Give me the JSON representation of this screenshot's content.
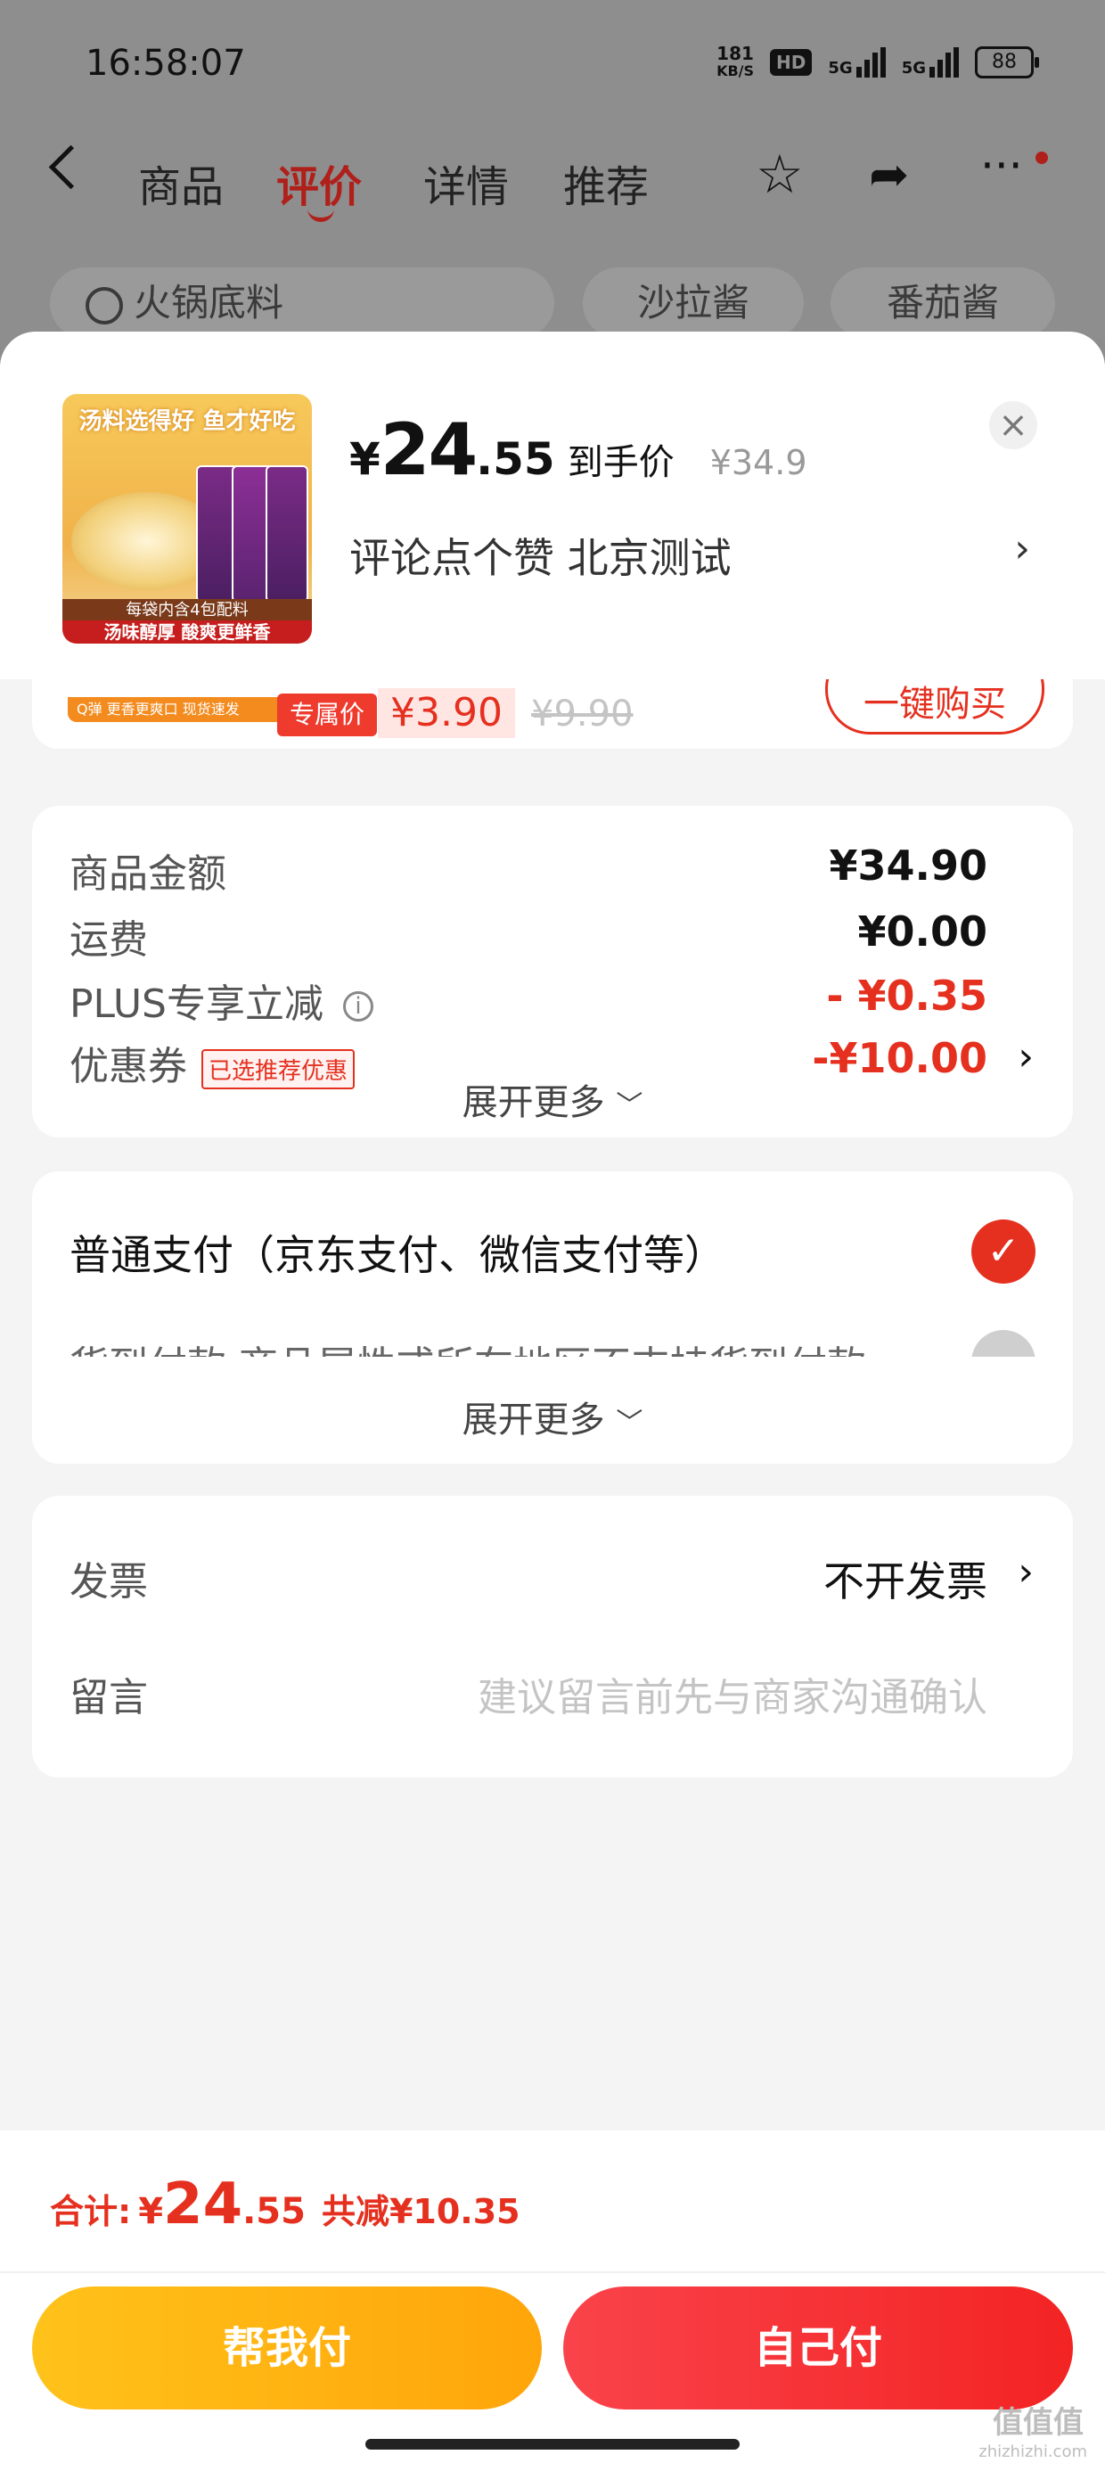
{
  "status_bar": {
    "time": "16:58:07",
    "net_speed_value": "181",
    "net_speed_unit": "KB/S",
    "hd_label": "HD",
    "signal1_label": "5G",
    "signal2_label": "5G",
    "battery": "88"
  },
  "nav": {
    "tabs": [
      {
        "label": "商品"
      },
      {
        "label": "评价"
      },
      {
        "label": "详情"
      },
      {
        "label": "推荐"
      }
    ],
    "active_tab": "评价",
    "icons": [
      "back-icon",
      "star-icon",
      "share-icon",
      "more-icon"
    ]
  },
  "search_row": {
    "search_text": "火锅底料",
    "chips": [
      "沙拉酱",
      "番茄酱"
    ]
  },
  "product": {
    "image_top_text": "汤料选得好 鱼才好吃",
    "image_band1": "每袋内含4包配料",
    "image_band2": "汤味醇厚 酸爽更鲜香",
    "price_symbol": "¥",
    "price_int": "24",
    "price_dec": ".55",
    "price_tag": "到手价",
    "orig_price": "¥34.9",
    "subtitle": "评论点个赞  北京测试"
  },
  "peek_item": {
    "label_text": "Q弹 更香更爽口  现货速发",
    "tag": "专属价",
    "price": "¥3.90",
    "orig_price": "¥9.90",
    "button": "一键购买"
  },
  "amounts": {
    "goods_label": "商品金额",
    "goods_value": "¥34.90",
    "shipping_label": "运费",
    "shipping_value": "¥0.00",
    "plus_label": "PLUS专享立减",
    "plus_value": "- ¥0.35",
    "coupon_label": "优惠券",
    "coupon_tag": "已选推荐优惠",
    "coupon_value": "-¥10.00",
    "expand": "展开更多"
  },
  "payment": {
    "normal_label": "普通支付（京东支付、微信支付等）",
    "cod_label": "货到付款 商品属性或所在地区不支持货到付款",
    "expand": "展开更多"
  },
  "extras": {
    "invoice_label": "发票",
    "invoice_value": "不开发票",
    "message_label": "留言",
    "message_placeholder": "建议留言前先与商家沟通确认"
  },
  "footer": {
    "total_label": "合计:",
    "total_symbol": "¥",
    "total_int": "24",
    "total_dec": ".55",
    "total_saving": "共减¥10.35",
    "help_pay_button": "帮我付",
    "self_pay_button": "自己付"
  },
  "watermark": {
    "main": "值值值",
    "sub": "zhizhizhi.com"
  },
  "colors": {
    "accent_red": "#e5301f",
    "help_pay_yellow": "#ffb414",
    "self_pay_red": "#f5363a"
  }
}
